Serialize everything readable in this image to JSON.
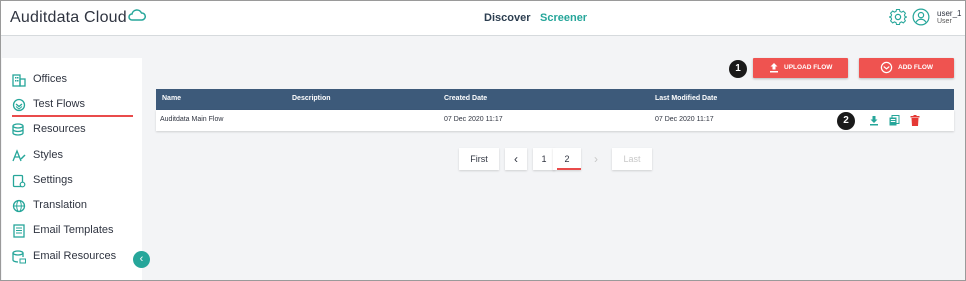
{
  "header": {
    "brand": "Auditdata Cloud",
    "nav": [
      {
        "label": "Discover",
        "active": true
      },
      {
        "label": "Screener",
        "active": false
      }
    ],
    "user": {
      "name": "user_1",
      "role": "User"
    }
  },
  "sidebar": {
    "items": [
      {
        "label": "Offices",
        "icon": "building-icon"
      },
      {
        "label": "Test Flows",
        "icon": "flow-icon",
        "active": true
      },
      {
        "label": "Resources",
        "icon": "database-icon"
      },
      {
        "label": "Styles",
        "icon": "text-style-icon"
      },
      {
        "label": "Settings",
        "icon": "settings-tablet-icon"
      },
      {
        "label": "Translation",
        "icon": "globe-icon"
      },
      {
        "label": "Email Templates",
        "icon": "document-icon"
      },
      {
        "label": "Email Resources",
        "icon": "database-mail-icon"
      }
    ]
  },
  "toolbar": {
    "upload_label": "UPLOAD FLOW",
    "add_label": "ADD FLOW",
    "badge_upload": "1",
    "badge_actions": "2"
  },
  "table": {
    "columns": [
      "Name",
      "Description",
      "Created Date",
      "Last Modified Date"
    ],
    "rows": [
      {
        "name": "Auditdata Main Flow",
        "description": "",
        "created": "07 Dec 2020 11:17",
        "modified": "07 Dec 2020 11:17"
      }
    ]
  },
  "pagination": {
    "first": "First",
    "prev": "‹",
    "pages": [
      "1",
      "2"
    ],
    "current": "2",
    "next": "›",
    "last": "Last"
  },
  "colors": {
    "accent_red": "#ef5350",
    "teal": "#26a69a",
    "table_header": "#3d5a7a"
  }
}
